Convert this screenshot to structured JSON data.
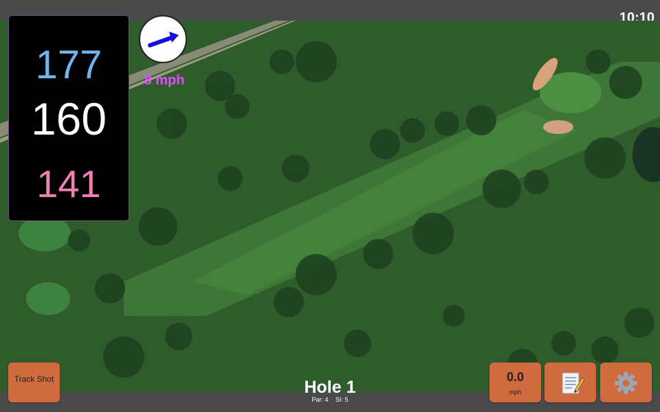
{
  "status_bar": {
    "time": "10:10"
  },
  "distances": {
    "back": "177",
    "center": "160",
    "front": "141"
  },
  "wind": {
    "direction_icon": "arrow-right-icon",
    "speed": "8 mph"
  },
  "hole": {
    "title": "Hole 1",
    "par": "Par: 4",
    "stroke_index": "SI: 5"
  },
  "buttons": {
    "track_shot": "Track Shot",
    "speed_value": "0.0",
    "speed_unit": "mph",
    "notes_icon": "notepad-icon",
    "settings_icon": "gear-icon"
  },
  "colors": {
    "back_distance": "#6fb4ec",
    "center_distance": "#ffffff",
    "front_distance": "#f07fb6",
    "wind_speed": "#e24bff",
    "button": "#cf6b3f",
    "wind_arrow": "#1010e0"
  }
}
